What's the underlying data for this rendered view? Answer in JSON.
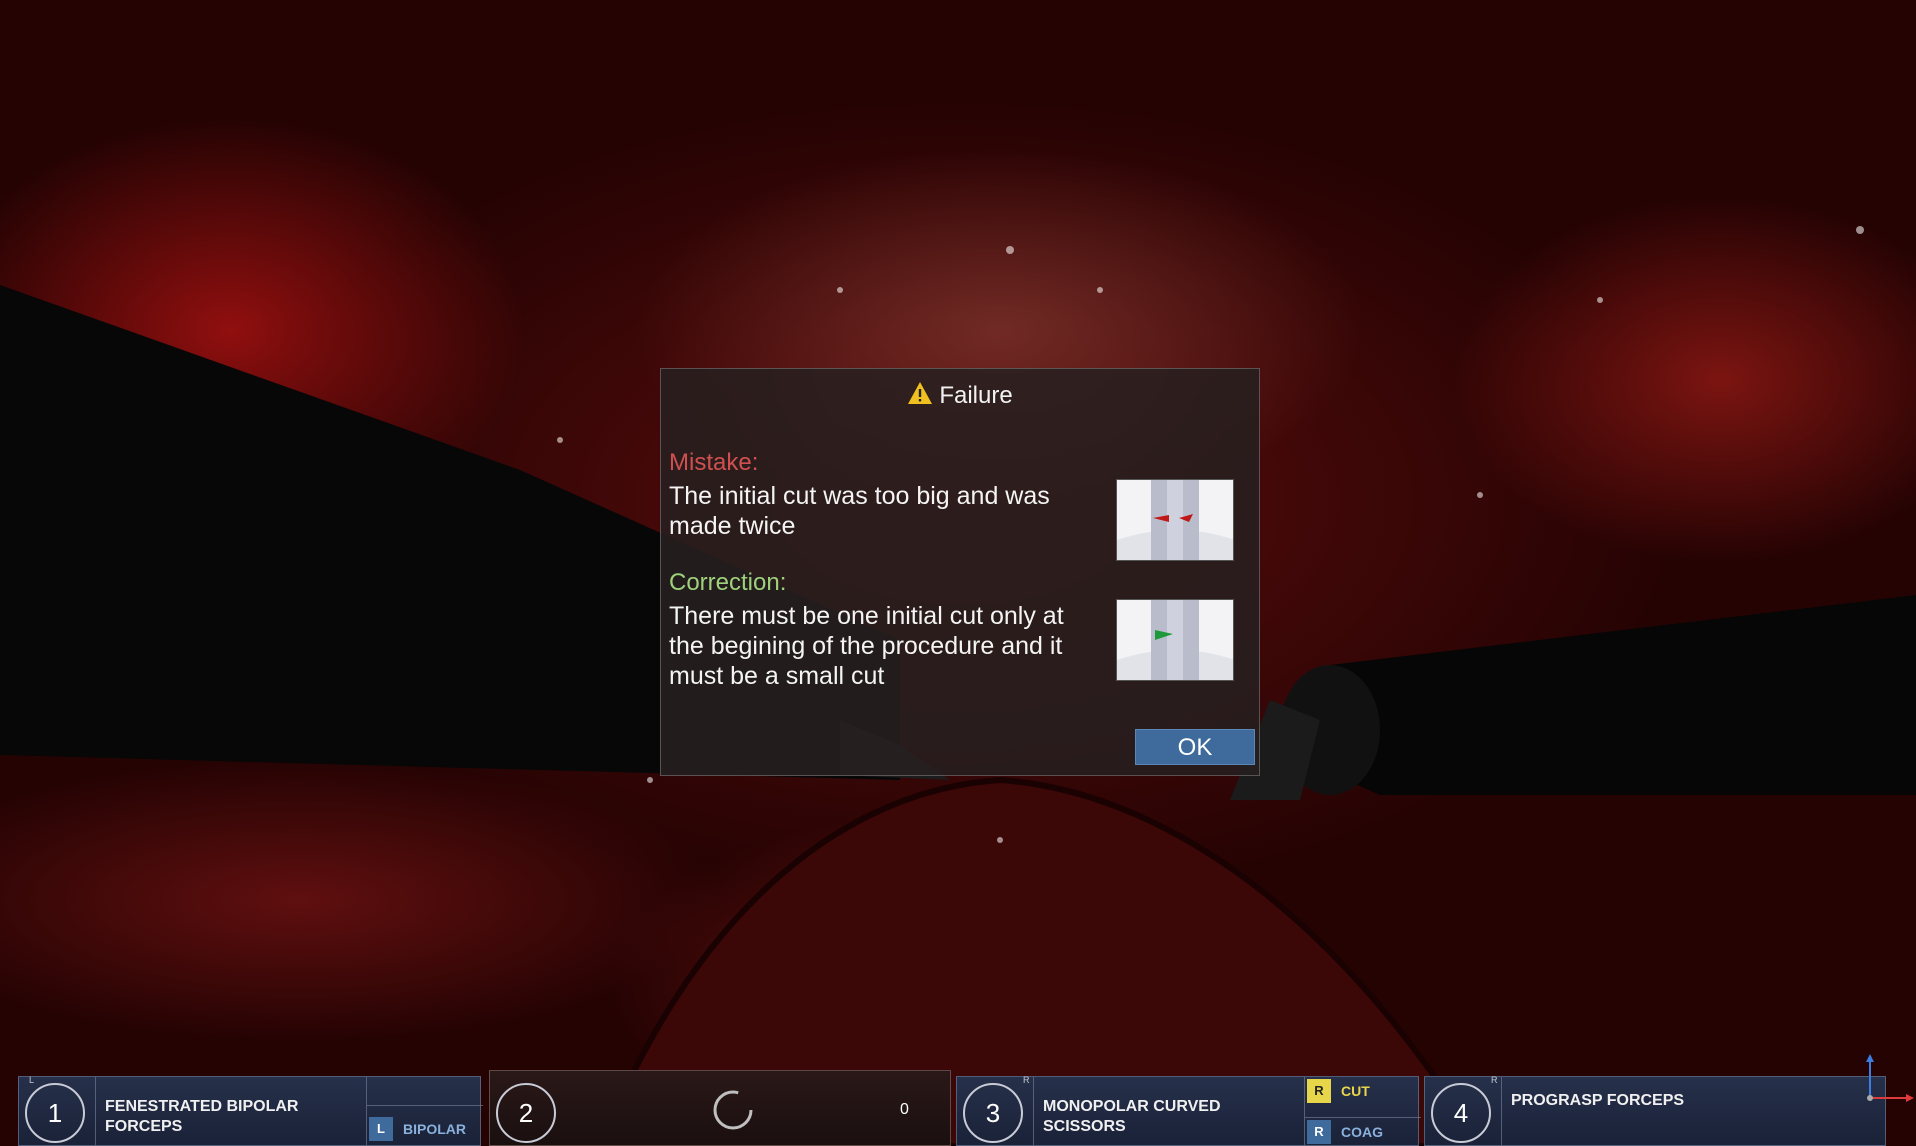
{
  "dialog": {
    "title": "Failure",
    "mistake_label": "Mistake:",
    "mistake_text": "The initial cut was too big and was made twice",
    "correction_label": "Correction:",
    "correction_text": "There must be one initial cut only at the begining of the procedure and it must be a small cut",
    "ok_label": "OK",
    "warning_icon": "warning-triangle-icon"
  },
  "toolbar": {
    "slot1": {
      "number": "1",
      "side": "L",
      "name": "FENESTRATED BIPOLAR FORCEPS",
      "mode_key": "L",
      "mode_label": "BIPOLAR"
    },
    "slot2": {
      "number": "2",
      "counter": "0",
      "spinner_icon": "loading-spinner-icon"
    },
    "slot3": {
      "number": "3",
      "side": "R",
      "name": "MONOPOLAR CURVED SCISSORS",
      "cut_key": "R",
      "cut_label": "CUT",
      "coag_key": "R",
      "coag_label": "COAG"
    },
    "slot4": {
      "number": "4",
      "side": "R",
      "name": "PROGRASP FORCEPS"
    }
  },
  "colors": {
    "mistake": "#d05050",
    "correction": "#9fd07c",
    "ok_button": "#3e6a9c",
    "cut_key": "#e8d64a",
    "coag_key": "#3e6a9c",
    "bipolar_key": "#3e6a9c"
  }
}
